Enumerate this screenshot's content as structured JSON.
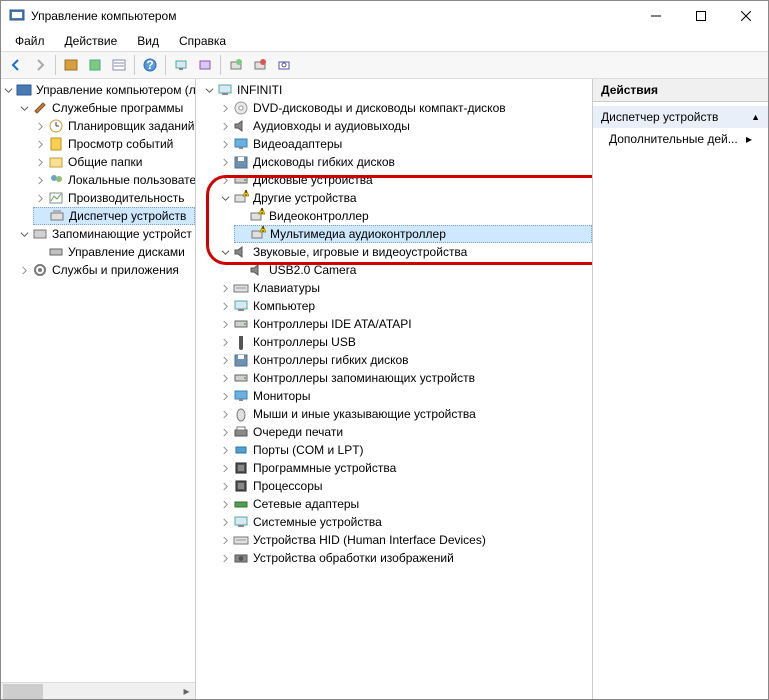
{
  "window": {
    "title": "Управление компьютером"
  },
  "menu": {
    "file": "Файл",
    "action": "Действие",
    "view": "Вид",
    "help": "Справка"
  },
  "leftTree": {
    "root": "Управление компьютером (л",
    "sysTools": "Служебные программы",
    "scheduler": "Планировщик заданий",
    "events": "Просмотр событий",
    "shared": "Общие папки",
    "users": "Локальные пользовате",
    "perf": "Производительность",
    "devmgr": "Диспетчер устройств",
    "storage": "Запоминающие устройст",
    "diskmgr": "Управление дисками",
    "services": "Службы и приложения"
  },
  "midTree": {
    "root": "INFINITI",
    "dvd": "DVD-дисководы и дисководы компакт-дисков",
    "audio": "Аудиовходы и аудиовыходы",
    "video": "Видеоадаптеры",
    "floppy": "Дисководы гибких дисков",
    "disk": "Дисковые устройства",
    "other": "Другие устройства",
    "vcontroller": "Видеоконтроллер",
    "multimedia": "Мультимедиа аудиоконтроллер",
    "sound": "Звуковые, игровые и видеоустройства",
    "usbcam": "USB2.0 Camera",
    "keyboard": "Клавиатуры",
    "computer": "Компьютер",
    "ide": "Контроллеры IDE ATA/ATAPI",
    "usb": "Контроллеры USB",
    "floppyCtrl": "Контроллеры гибких дисков",
    "storageCtrl": "Контроллеры запоминающих устройств",
    "monitor": "Мониторы",
    "mouse": "Мыши и иные указывающие устройства",
    "printq": "Очереди печати",
    "ports": "Порты (COM и LPT)",
    "software": "Программные устройства",
    "cpu": "Процессоры",
    "network": "Сетевые адаптеры",
    "system": "Системные устройства",
    "hid": "Устройства HID (Human Interface Devices)",
    "imaging": "Устройства обработки изображений"
  },
  "actions": {
    "header": "Действия",
    "section": "Диспетчер устройств",
    "more": "Дополнительные дей..."
  }
}
